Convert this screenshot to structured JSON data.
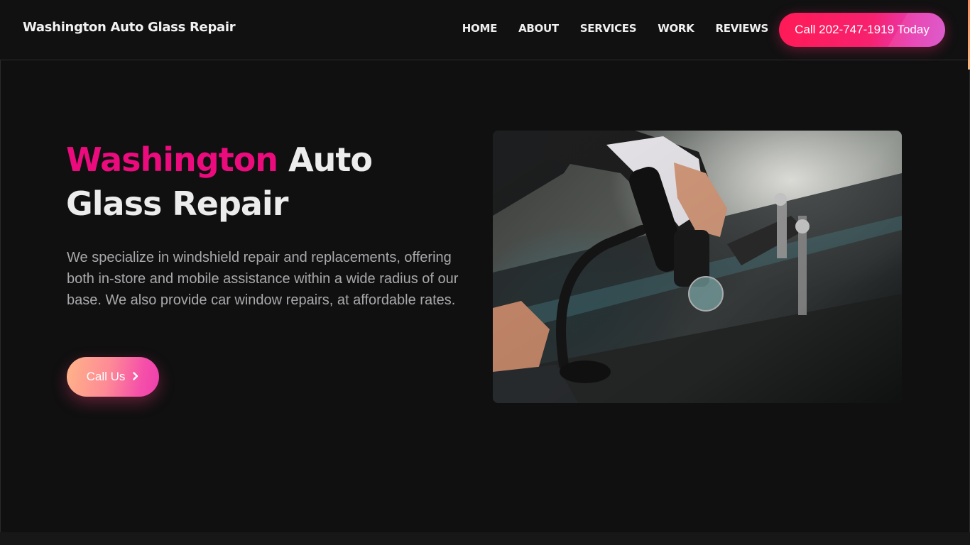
{
  "header": {
    "brand": "Washington Auto Glass Repair",
    "nav": [
      "HOME",
      "ABOUT",
      "SERVICES",
      "WORK",
      "REVIEWS"
    ],
    "call_label": "Call 202-747-1919 Today"
  },
  "hero": {
    "title_accent": "Washington",
    "title_rest": " Auto Glass Repair",
    "description": "We specialize in windshield repair and replacements, offering both in-store and mobile assistance within a wide radius of our base. We also provide car window repairs, at affordable rates.",
    "cta_label": "Call Us",
    "cta_icon": "chevron-right-icon",
    "image_alt": "Technician repairing a car windshield with a glass repair tool"
  },
  "colors": {
    "background": "#101011",
    "accent": "#ec0b7d",
    "call_button": "#ff1a56",
    "cta_gradient_start": "#ffb488",
    "cta_gradient_end": "#ee3fae"
  }
}
